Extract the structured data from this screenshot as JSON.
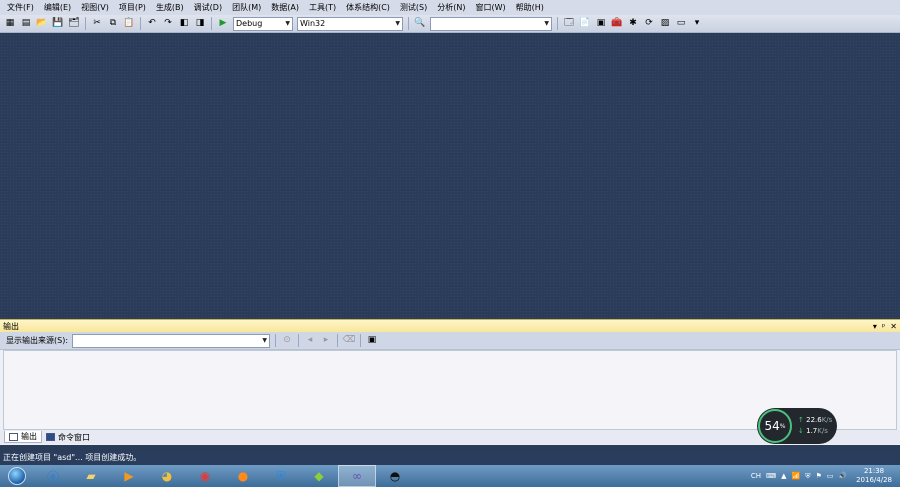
{
  "menu": [
    "文件(F)",
    "编辑(E)",
    "视图(V)",
    "项目(P)",
    "生成(B)",
    "调试(D)",
    "团队(M)",
    "数据(A)",
    "工具(T)",
    "体系结构(C)",
    "测试(S)",
    "分析(N)",
    "窗口(W)",
    "帮助(H)"
  ],
  "toolbar": {
    "config": "Debug",
    "platform": "Win32",
    "find_value": ""
  },
  "output": {
    "title": "输出",
    "source_label": "显示输出来源(S):",
    "source_value": "",
    "tabs": [
      "输出",
      "命令窗口"
    ]
  },
  "status": "正在创建项目 \"asd\"... 项目创建成功。",
  "widget": {
    "percent": "54",
    "percent_unit": "%",
    "upload": "22.6",
    "upload_unit": "K/s",
    "download": "1.7",
    "download_unit": "K/s"
  },
  "tray": {
    "ime": "CH",
    "time": "21:38",
    "date": "2016/4/28"
  }
}
